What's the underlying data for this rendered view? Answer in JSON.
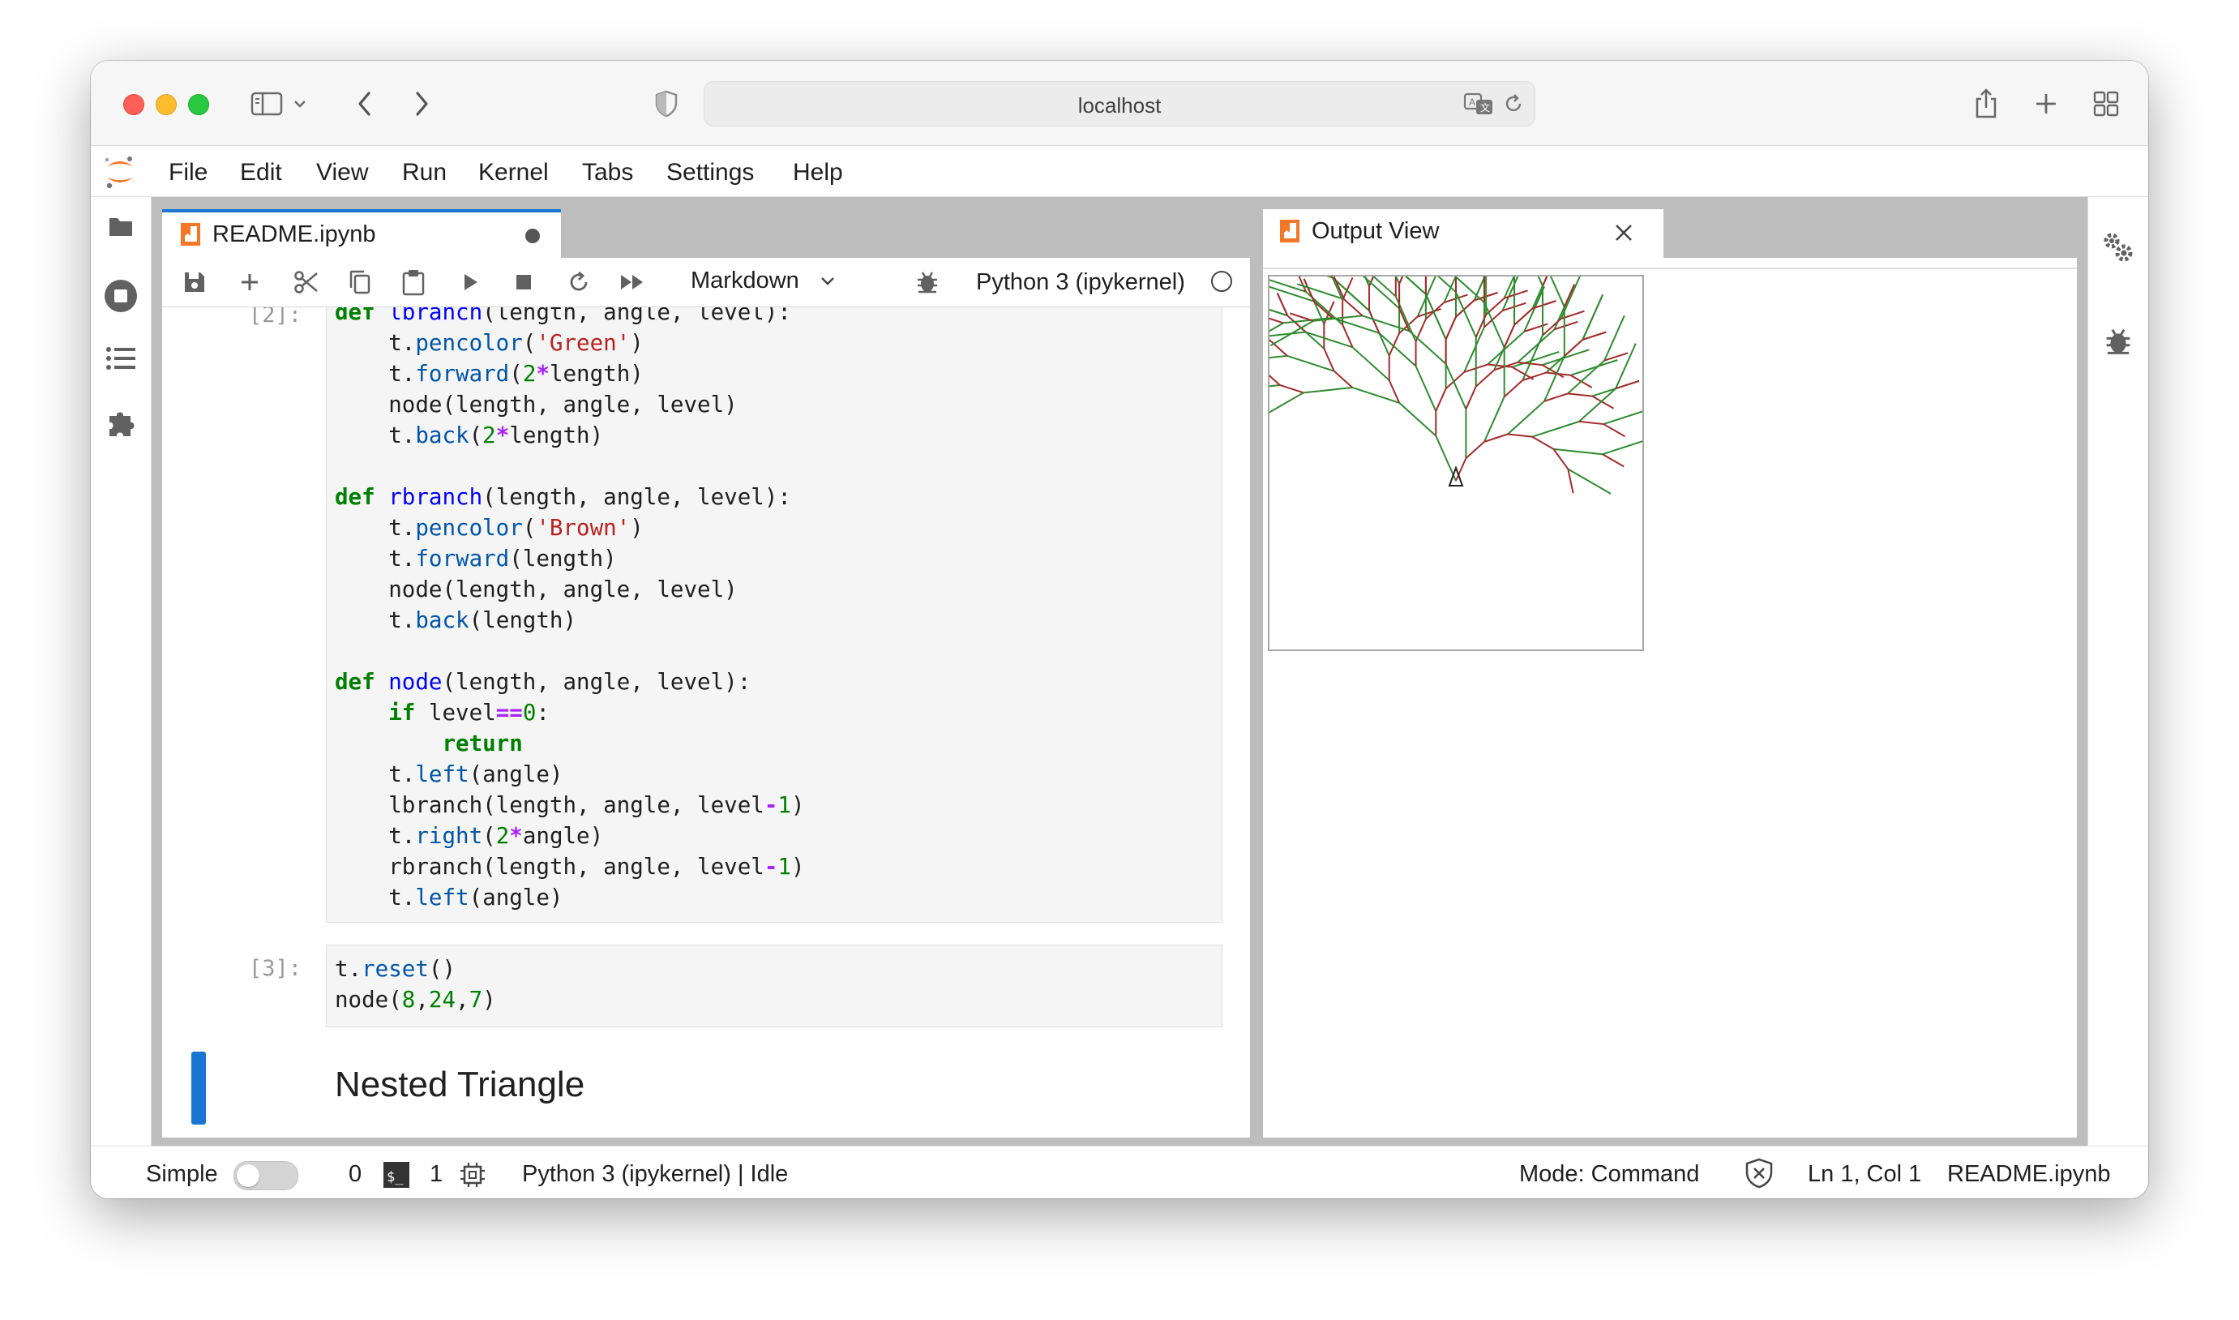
{
  "browser": {
    "url": "localhost"
  },
  "menu": {
    "items": [
      "File",
      "Edit",
      "View",
      "Run",
      "Kernel",
      "Tabs",
      "Settings",
      "Help"
    ]
  },
  "notebook": {
    "tab_title": "README.ipynb",
    "cell_type": "Markdown",
    "kernel": "Python 3 (ipykernel)",
    "cells": [
      {
        "prompt": "[2]:"
      },
      {
        "prompt": "[3]:"
      }
    ],
    "markdown_heading": "Nested Triangle"
  },
  "output_view": {
    "tab_title": "Output View"
  },
  "status": {
    "simple_label": "Simple",
    "terminals_count": "0",
    "kernels_count": "1",
    "kernel_status": "Python 3 (ipykernel) | Idle",
    "mode": "Mode: Command",
    "cursor": "Ln 1, Col 1",
    "file": "README.ipynb"
  },
  "colors": {
    "accent": "#1976d2",
    "tree_green": "#2e8b2e",
    "tree_brown": "#a52a2a"
  }
}
